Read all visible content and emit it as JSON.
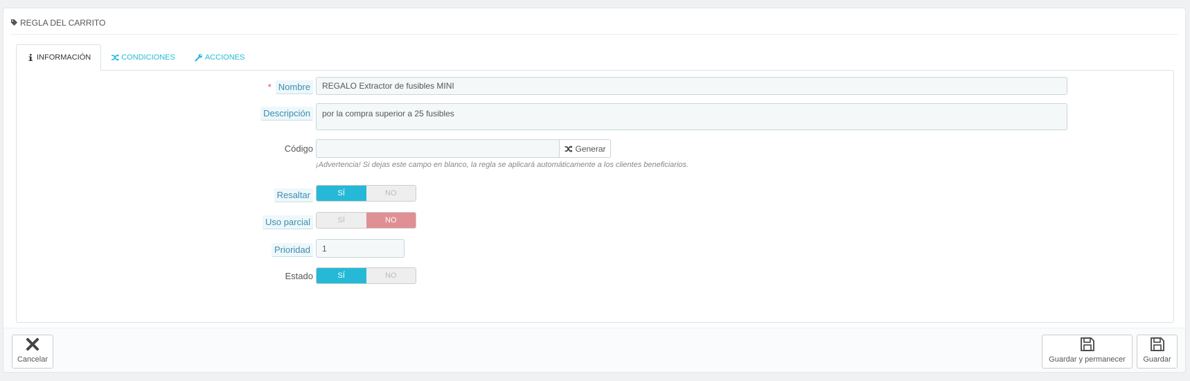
{
  "panel": {
    "title": "REGLA DEL CARRITO"
  },
  "tabs": [
    {
      "label": "INFORMACIÓN",
      "icon": "info-icon",
      "active": true
    },
    {
      "label": "CONDICIONES",
      "icon": "random-icon",
      "active": false
    },
    {
      "label": "ACCIONES",
      "icon": "wrench-icon",
      "active": false
    }
  ],
  "form": {
    "nombre": {
      "label": "Nombre",
      "required_mark": "*",
      "value": "REGALO Extractor de fusibles MINI"
    },
    "descripcion": {
      "label": "Descripción",
      "value": "por la compra superior a 25 fusibles"
    },
    "codigo": {
      "label": "Código",
      "value": "",
      "generate_label": "Generar",
      "help": "¡Advertencia! Si dejas este campo en blanco, la regla se aplicará automáticamente a los clientes beneficiarios."
    },
    "resaltar": {
      "label": "Resaltar",
      "yes": "SÍ",
      "no": "NO",
      "selected": "yes"
    },
    "uso_parcial": {
      "label": "Uso parcial",
      "yes": "SÍ",
      "no": "NO",
      "selected": "no"
    },
    "prioridad": {
      "label": "Prioridad",
      "value": "1"
    },
    "estado": {
      "label": "Estado",
      "yes": "SÍ",
      "no": "NO",
      "selected": "yes"
    }
  },
  "footer": {
    "cancel": "Cancelar",
    "save_stay": "Guardar y permanecer",
    "save": "Guardar"
  },
  "colors": {
    "accent": "#25b9d7",
    "no_active": "#e08f95",
    "label_hint": "#3c8db0"
  }
}
